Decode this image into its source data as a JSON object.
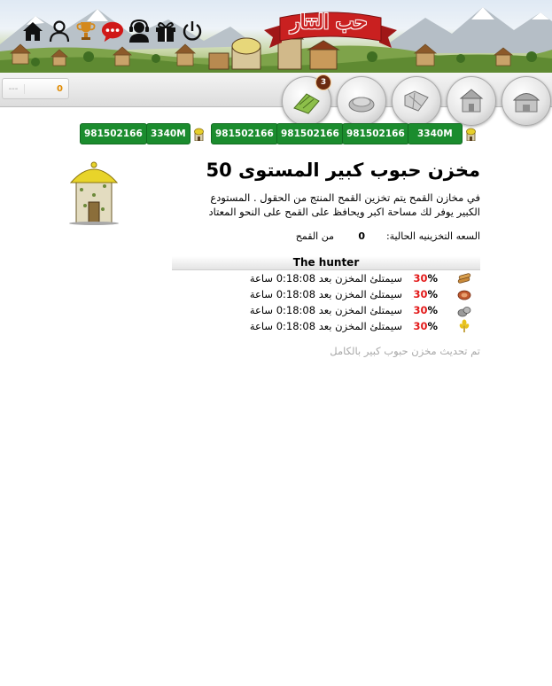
{
  "header": {
    "logo_text": "حب التتار",
    "icons": [
      "home-icon",
      "user-icon",
      "trophy-icon",
      "chat-icon",
      "support-icon",
      "gift-icon",
      "power-icon"
    ]
  },
  "bar": {
    "counter_dash": "---",
    "counter_value": "0",
    "circle_buttons": [
      {
        "name": "wheat-field-circle",
        "badge": "3"
      },
      {
        "name": "farm-circle"
      },
      {
        "name": "map-circle"
      },
      {
        "name": "barracks-circle"
      },
      {
        "name": "storage-circle"
      }
    ]
  },
  "resources": [
    {
      "icon": "wheat-icon",
      "value": "981502166"
    },
    {
      "icon": "tower-icon",
      "value": "3340M"
    },
    {
      "icon": "stone-icon",
      "value": "981502166"
    },
    {
      "icon": "meat-icon",
      "value": "981502166"
    },
    {
      "icon": "wood-icon",
      "value": "981502166"
    },
    {
      "icon": "tower-icon",
      "value": "3340M"
    }
  ],
  "building": {
    "title": "مخزن حبوب كبير المستوى 50",
    "description": "في مخازن القمح يتم تخزين القمح المنتج من الحقول . المستودع الكبير يوفر لك مساحة اكبر ويحافظ على القمح على النحو المعتاد",
    "capacity_label": "السعه التخزينيه الحالية:",
    "capacity_value": "0",
    "capacity_unit": "من القمح",
    "hunter_title": "The hunter",
    "fill_rows": [
      {
        "icon": "wood-icon",
        "percent": "30",
        "percent_sign": "%",
        "text": "سيمتلئ المخزن بعد 0:18:08 ساعة"
      },
      {
        "icon": "meat-icon",
        "percent": "30",
        "percent_sign": "%",
        "text": "سيمتلئ المخزن بعد 0:18:08 ساعة"
      },
      {
        "icon": "stone-icon",
        "percent": "30",
        "percent_sign": "%",
        "text": "سيمتلئ المخزن بعد 0:18:08 ساعة"
      },
      {
        "icon": "wheat-icon",
        "percent": "30",
        "percent_sign": "%",
        "text": "سيمتلئ المخزن بعد 0:18:08 ساعة"
      }
    ],
    "updated_note": "تم تحديث مخزن حبوب كبير بالكامل"
  },
  "colors": {
    "pill_green": "#1b8c2e",
    "percent_red": "#e31b1b",
    "counter_orange": "#e08a00",
    "muted_gray": "#a9a9a9"
  }
}
